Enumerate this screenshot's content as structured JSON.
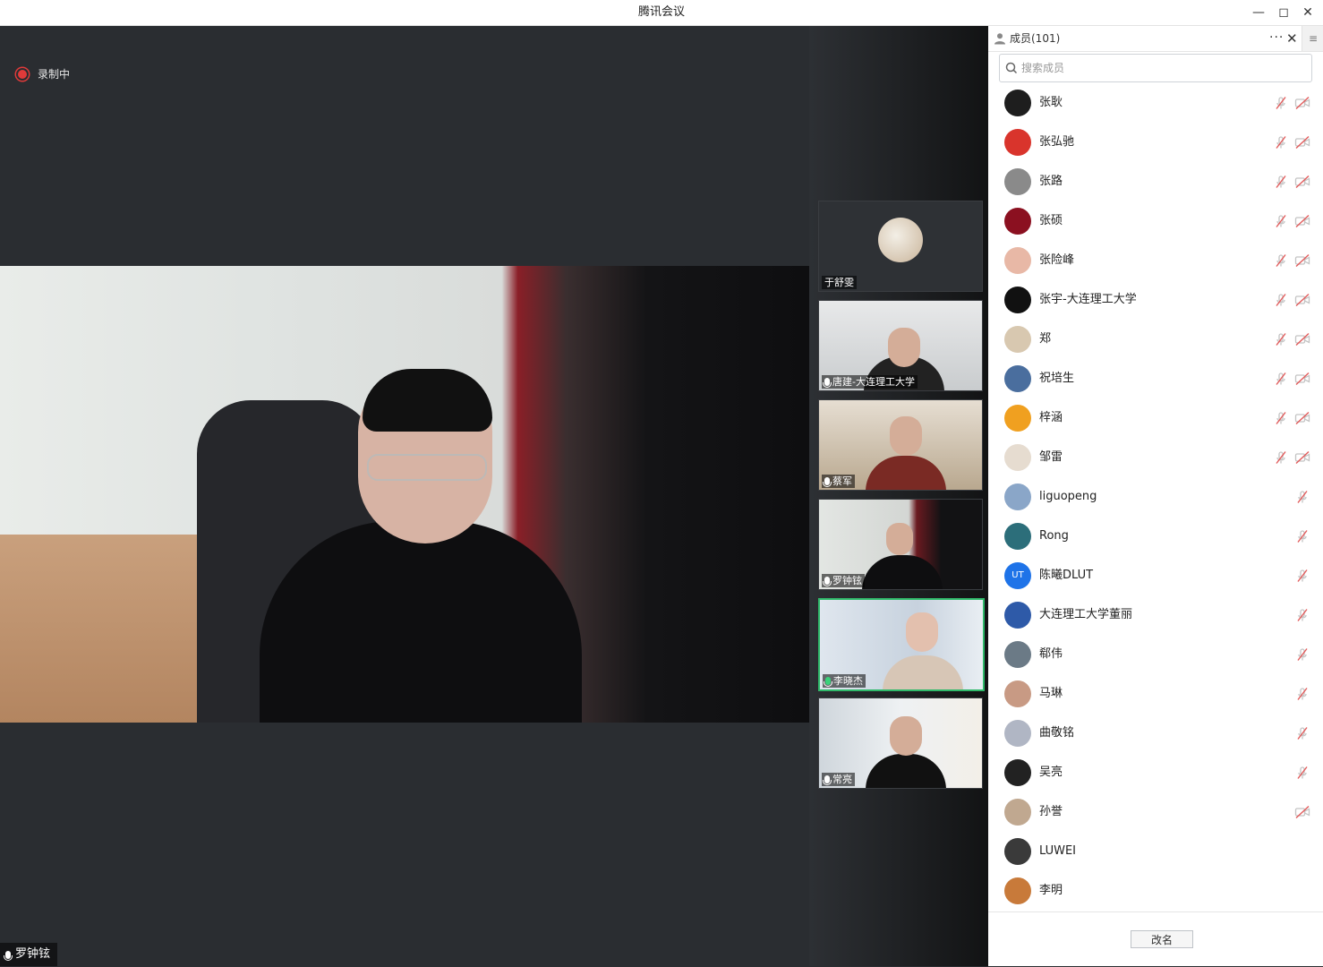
{
  "window": {
    "title": "腾讯会议"
  },
  "recording": {
    "label": "录制中"
  },
  "main_speaker": {
    "name": "罗钟铉"
  },
  "tiles": [
    {
      "name": "于舒雯",
      "mic": false,
      "active": false
    },
    {
      "name": "唐建-大连理工大学",
      "mic": true,
      "active": false
    },
    {
      "name": "蔡军",
      "mic": true,
      "active": false
    },
    {
      "name": "罗钟铉",
      "mic": true,
      "active": false
    },
    {
      "name": "李晓杰",
      "mic": true,
      "active": true
    },
    {
      "name": "常亮",
      "mic": true,
      "active": false
    }
  ],
  "panel": {
    "title": "成员(101)",
    "more_label": "···",
    "close_label": "✕",
    "search_placeholder": "搜索成员",
    "rename_label": "改名"
  },
  "members": [
    {
      "name": "张耿",
      "avatar_color": "#1e1e1e",
      "mic_muted": true,
      "cam_off": true
    },
    {
      "name": "张弘驰",
      "avatar_color": "#d9342c",
      "mic_muted": true,
      "cam_off": true
    },
    {
      "name": "张路",
      "avatar_color": "#8a8a8a",
      "mic_muted": true,
      "cam_off": true
    },
    {
      "name": "张硕",
      "avatar_color": "#8b1020",
      "mic_muted": true,
      "cam_off": true
    },
    {
      "name": "张险峰",
      "avatar_color": "#e8b8a6",
      "mic_muted": true,
      "cam_off": true
    },
    {
      "name": "张宇-大连理工大学",
      "avatar_color": "#111111",
      "mic_muted": true,
      "cam_off": true
    },
    {
      "name": "郑",
      "avatar_color": "#d8c8b0",
      "mic_muted": true,
      "cam_off": true
    },
    {
      "name": "祝培生",
      "avatar_color": "#4a6e9e",
      "mic_muted": true,
      "cam_off": true
    },
    {
      "name": "梓涵",
      "avatar_color": "#f0a020",
      "mic_muted": true,
      "cam_off": true
    },
    {
      "name": "邹雷",
      "avatar_color": "#e6dcd0",
      "mic_muted": true,
      "cam_off": true
    },
    {
      "name": "liguopeng",
      "avatar_color": "#8aa6c8",
      "mic_muted": true,
      "cam_off": false
    },
    {
      "name": "Rong",
      "avatar_color": "#2c6e7a",
      "mic_muted": true,
      "cam_off": false
    },
    {
      "name": "陈曦DLUT",
      "avatar_color": "#1e73e8",
      "avatar_text": "UT",
      "mic_muted": true,
      "cam_off": false
    },
    {
      "name": "大连理工大学董丽",
      "avatar_color": "#2e5aa8",
      "mic_muted": true,
      "cam_off": false
    },
    {
      "name": "郗伟",
      "avatar_color": "#6b7a86",
      "mic_muted": true,
      "cam_off": false
    },
    {
      "name": "马琳",
      "avatar_color": "#c89a84",
      "mic_muted": true,
      "cam_off": false
    },
    {
      "name": "曲敬铭",
      "avatar_color": "#b0b6c4",
      "mic_muted": true,
      "cam_off": false
    },
    {
      "name": "吴亮",
      "avatar_color": "#222222",
      "mic_muted": true,
      "cam_off": false
    },
    {
      "name": "孙誉",
      "avatar_color": "#c0a890",
      "mic_muted": false,
      "cam_off": true
    },
    {
      "name": "LUWEI",
      "avatar_color": "#3a3a3a",
      "mic_muted": false,
      "cam_off": false
    },
    {
      "name": "李明",
      "avatar_color": "#c87a3a",
      "mic_muted": false,
      "cam_off": false
    }
  ]
}
